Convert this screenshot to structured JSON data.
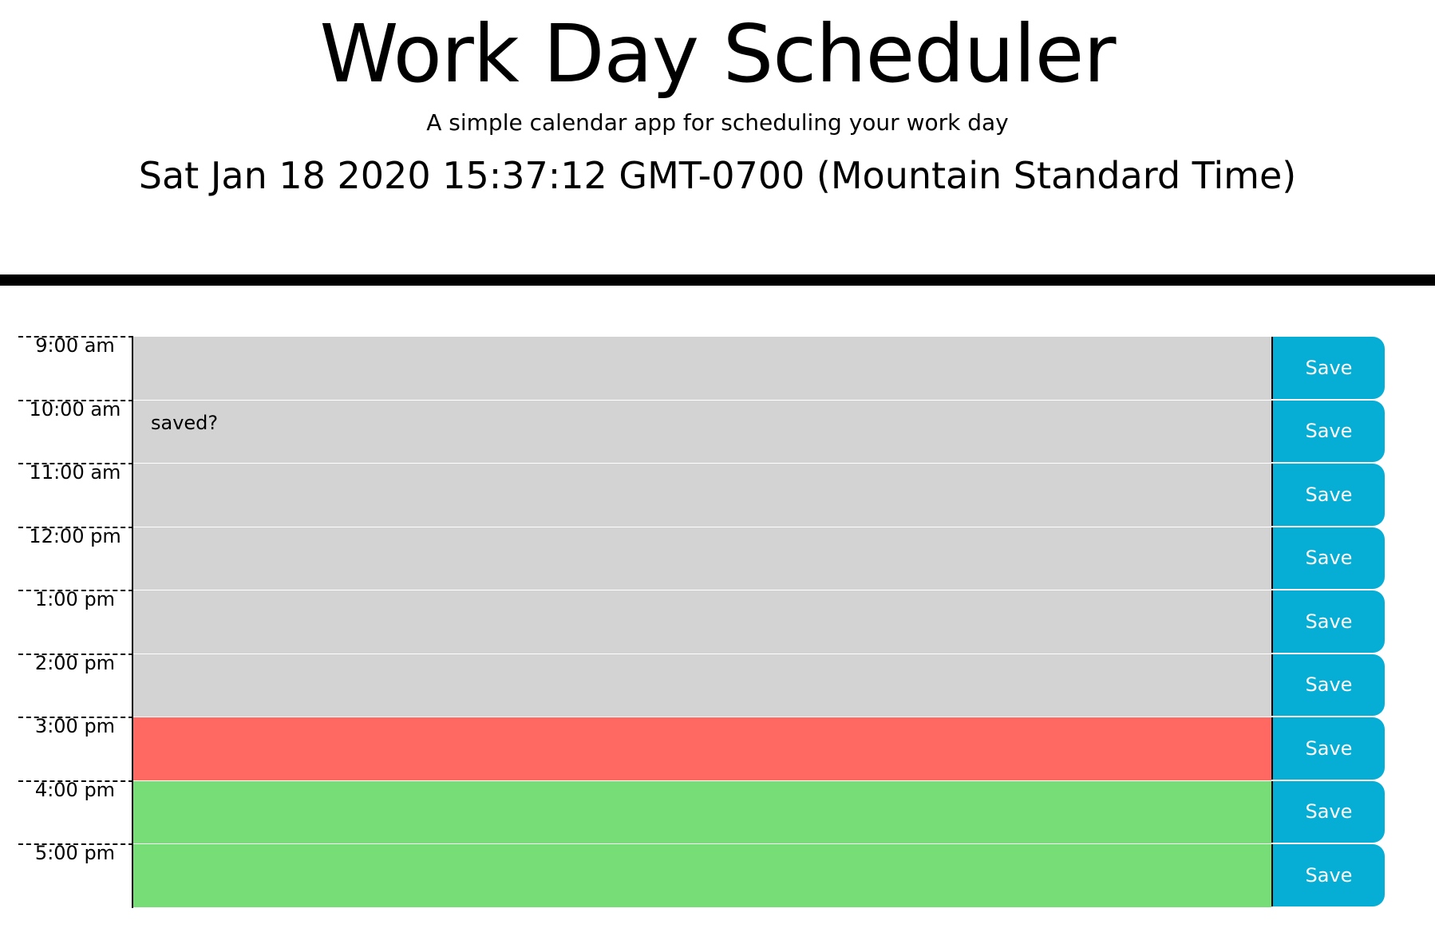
{
  "header": {
    "title": "Work Day Scheduler",
    "subtitle": "A simple calendar app for scheduling your work day",
    "current_day": "Sat Jan 18 2020 15:37:12 GMT-0700 (Mountain Standard Time)"
  },
  "colors": {
    "past": "#d3d3d3",
    "present": "#ff6961",
    "future": "#77dd77",
    "save_button": "#06aed5"
  },
  "rows": [
    {
      "hour": "9:00 am",
      "text": "",
      "state": "past",
      "save_label": "Save"
    },
    {
      "hour": "10:00 am",
      "text": "saved?",
      "state": "past",
      "save_label": "Save"
    },
    {
      "hour": "11:00 am",
      "text": "",
      "state": "past",
      "save_label": "Save"
    },
    {
      "hour": "12:00 pm",
      "text": "",
      "state": "past",
      "save_label": "Save"
    },
    {
      "hour": "1:00 pm",
      "text": "",
      "state": "past",
      "save_label": "Save"
    },
    {
      "hour": "2:00 pm",
      "text": "",
      "state": "past",
      "save_label": "Save"
    },
    {
      "hour": "3:00 pm",
      "text": "",
      "state": "present",
      "save_label": "Save"
    },
    {
      "hour": "4:00 pm",
      "text": "",
      "state": "future",
      "save_label": "Save"
    },
    {
      "hour": "5:00 pm",
      "text": "",
      "state": "future",
      "save_label": "Save"
    }
  ]
}
